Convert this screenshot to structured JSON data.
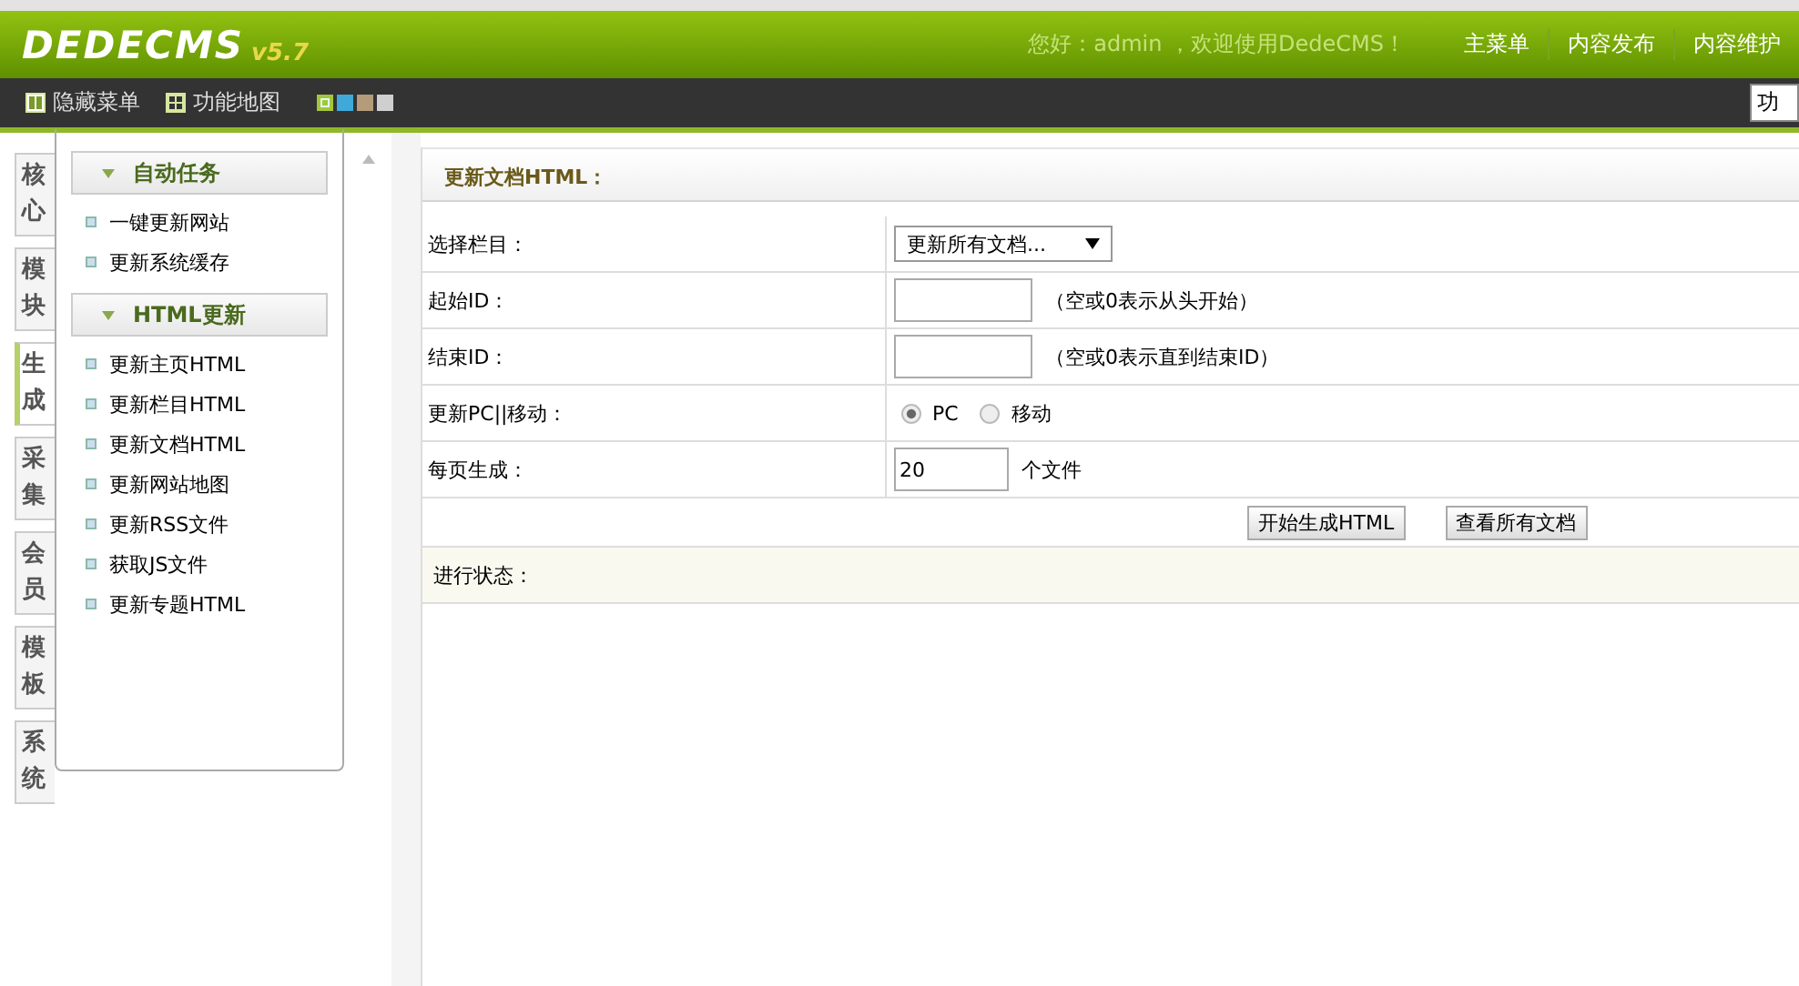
{
  "header": {
    "logo": "DEDECMS",
    "version": "v5.7",
    "welcome": "您好：admin ，欢迎使用DedeCMS！",
    "nav": [
      {
        "label": "主菜单"
      },
      {
        "label": "内容发布"
      },
      {
        "label": "内容维护"
      }
    ]
  },
  "toolbar": {
    "items": [
      {
        "label": "隐藏菜单",
        "kind": "hide"
      },
      {
        "label": "功能地图",
        "kind": "map"
      }
    ],
    "skins": [
      {
        "color": "#a4c63a",
        "selected": true
      },
      {
        "color": "#3fa9d9",
        "selected": false
      },
      {
        "color": "#b49b7a",
        "selected": false
      },
      {
        "color": "#cfcfcf",
        "selected": false
      }
    ],
    "search": "功"
  },
  "side_tabs": [
    {
      "label": "核心",
      "selected": false
    },
    {
      "label": "模块",
      "selected": false
    },
    {
      "label": "生成",
      "selected": true
    },
    {
      "label": "采集",
      "selected": false
    },
    {
      "label": "会员",
      "selected": false
    },
    {
      "label": "模板",
      "selected": false
    },
    {
      "label": "系统",
      "selected": false
    }
  ],
  "menu": [
    {
      "title": "自动任务",
      "items": [
        "一键更新网站",
        "更新系统缓存"
      ]
    },
    {
      "title": "HTML更新",
      "items": [
        "更新主页HTML",
        "更新栏目HTML",
        "更新文档HTML",
        "更新网站地图",
        "更新RSS文件",
        "获取JS文件",
        "更新专题HTML"
      ]
    }
  ],
  "panel": {
    "title": "更新文档HTML：",
    "rows": [
      {
        "label": "选择栏目：",
        "kind": "select",
        "value": "更新所有文档..."
      },
      {
        "label": "起始ID：",
        "kind": "input",
        "hint": "（空或0表示从头开始）"
      },
      {
        "label": "结束ID：",
        "kind": "input",
        "hint": "（空或0表示直到结束ID）"
      },
      {
        "label": "更新PC||移动：",
        "kind": "radio",
        "options": [
          {
            "label": "PC",
            "selected": true
          },
          {
            "label": "移动",
            "selected": false
          }
        ]
      },
      {
        "label": "每页生成：",
        "kind": "input",
        "value": "20",
        "hint": "个文件"
      }
    ],
    "buttons": [
      "开始生成HTML",
      "查看所有文档"
    ],
    "status_label": "进行状态："
  }
}
